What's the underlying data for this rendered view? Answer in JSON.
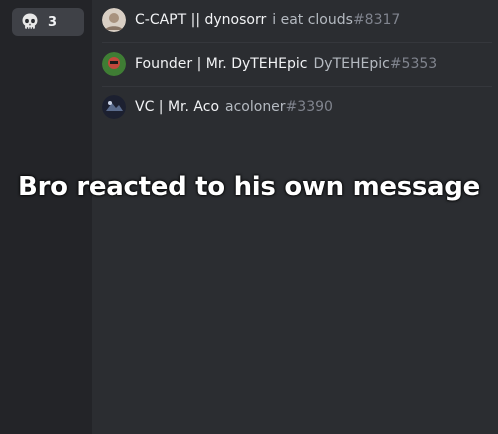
{
  "reaction": {
    "emoji_icon": "skull-icon",
    "count": "3"
  },
  "reactors": [
    {
      "display_name": "C-CAPT || dynosorr",
      "username": "i eat clouds",
      "discriminator": "#8317",
      "avatar_color": "#c9b7a6"
    },
    {
      "display_name": "Founder | Mr. DyTEHEpic",
      "username": "DyTEHEpic",
      "discriminator": "#5353",
      "avatar_color": "#4c8a3a"
    },
    {
      "display_name": "VC | Mr. Aco",
      "username": "acoloner",
      "discriminator": "#3390",
      "avatar_color": "#1e2230"
    }
  ],
  "caption": "Bro reacted to his own message",
  "colors": {
    "sidebar_bg": "#232428",
    "main_bg": "#2b2d31",
    "pill_bg": "#3f4147"
  }
}
